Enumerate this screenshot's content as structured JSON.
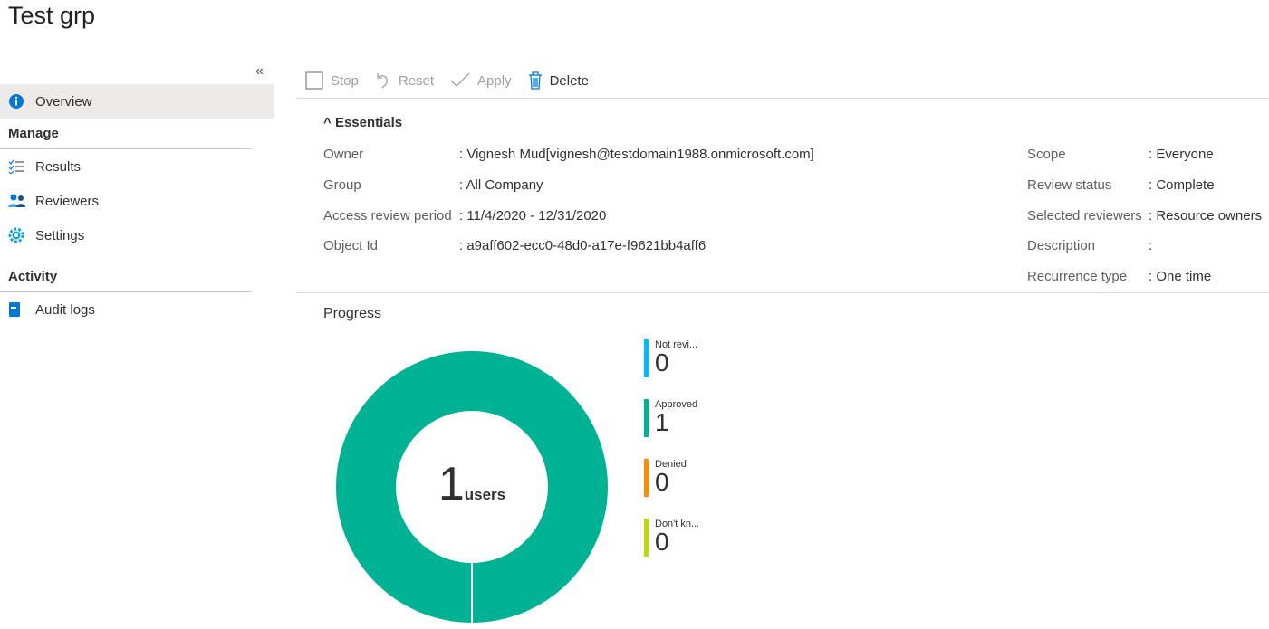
{
  "page_title": "Test grp",
  "sidebar": {
    "collapse_icon": "double-chevron-left",
    "overview": "Overview",
    "sections": [
      {
        "label": "Manage",
        "items": [
          {
            "label": "Results",
            "icon": "checklist-icon"
          },
          {
            "label": "Reviewers",
            "icon": "people-icon"
          },
          {
            "label": "Settings",
            "icon": "gear-icon"
          }
        ]
      },
      {
        "label": "Activity",
        "items": [
          {
            "label": "Audit logs",
            "icon": "book-icon"
          }
        ]
      }
    ]
  },
  "toolbar": {
    "stop": "Stop",
    "reset": "Reset",
    "apply": "Apply",
    "delete": "Delete"
  },
  "essentials": {
    "title": "Essentials",
    "left": [
      {
        "key": "Owner",
        "value": "Vignesh Mud[vignesh@testdomain1988.onmicrosoft.com]"
      },
      {
        "key": "Group",
        "value": "All Company"
      },
      {
        "key": "Access review period",
        "value": "11/4/2020 - 12/31/2020"
      },
      {
        "key": "Object Id",
        "value": "a9aff602-ecc0-48d0-a17e-f9621bb4aff6"
      }
    ],
    "right": [
      {
        "key": "Scope",
        "value": "Everyone"
      },
      {
        "key": "Review status",
        "value": "Complete"
      },
      {
        "key": "Selected reviewers",
        "value": "Resource owners"
      },
      {
        "key": "Description",
        "value": ""
      },
      {
        "key": "Recurrence type",
        "value": "One time"
      }
    ]
  },
  "progress": {
    "title": "Progress",
    "total": "1",
    "unit": "users"
  },
  "chart_data": {
    "type": "pie",
    "categories": [
      "Not revi...",
      "Approved",
      "Denied",
      "Don't kn..."
    ],
    "values": [
      0,
      1,
      0,
      0
    ],
    "colors": [
      "#00bcf2",
      "#00b294",
      "#ff8c00",
      "#bad80a"
    ]
  }
}
